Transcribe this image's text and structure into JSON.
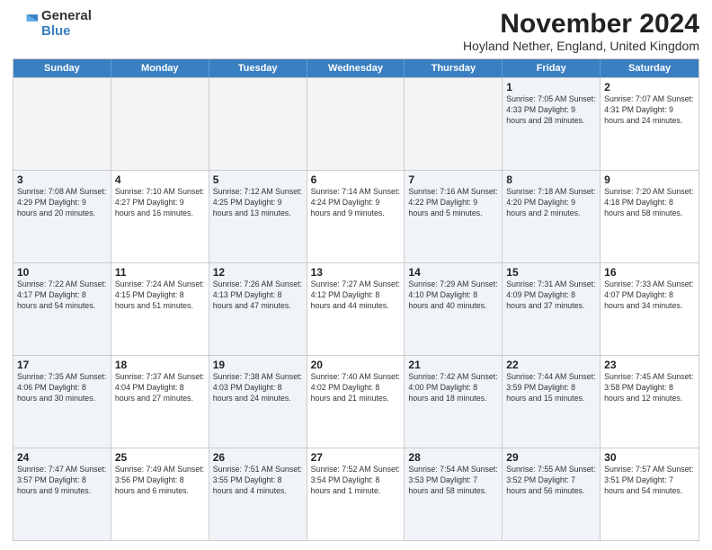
{
  "logo": {
    "general": "General",
    "blue": "Blue"
  },
  "header": {
    "title": "November 2024",
    "subtitle": "Hoyland Nether, England, United Kingdom"
  },
  "days_of_week": [
    "Sunday",
    "Monday",
    "Tuesday",
    "Wednesday",
    "Thursday",
    "Friday",
    "Saturday"
  ],
  "rows": [
    [
      {
        "day": "",
        "info": "",
        "empty": true
      },
      {
        "day": "",
        "info": "",
        "empty": true
      },
      {
        "day": "",
        "info": "",
        "empty": true
      },
      {
        "day": "",
        "info": "",
        "empty": true
      },
      {
        "day": "",
        "info": "",
        "empty": true
      },
      {
        "day": "1",
        "info": "Sunrise: 7:05 AM\nSunset: 4:33 PM\nDaylight: 9 hours and 28 minutes.",
        "shaded": true
      },
      {
        "day": "2",
        "info": "Sunrise: 7:07 AM\nSunset: 4:31 PM\nDaylight: 9 hours and 24 minutes."
      }
    ],
    [
      {
        "day": "3",
        "info": "Sunrise: 7:08 AM\nSunset: 4:29 PM\nDaylight: 9 hours and 20 minutes.",
        "shaded": true
      },
      {
        "day": "4",
        "info": "Sunrise: 7:10 AM\nSunset: 4:27 PM\nDaylight: 9 hours and 16 minutes."
      },
      {
        "day": "5",
        "info": "Sunrise: 7:12 AM\nSunset: 4:25 PM\nDaylight: 9 hours and 13 minutes.",
        "shaded": true
      },
      {
        "day": "6",
        "info": "Sunrise: 7:14 AM\nSunset: 4:24 PM\nDaylight: 9 hours and 9 minutes."
      },
      {
        "day": "7",
        "info": "Sunrise: 7:16 AM\nSunset: 4:22 PM\nDaylight: 9 hours and 5 minutes.",
        "shaded": true
      },
      {
        "day": "8",
        "info": "Sunrise: 7:18 AM\nSunset: 4:20 PM\nDaylight: 9 hours and 2 minutes.",
        "shaded": true
      },
      {
        "day": "9",
        "info": "Sunrise: 7:20 AM\nSunset: 4:18 PM\nDaylight: 8 hours and 58 minutes."
      }
    ],
    [
      {
        "day": "10",
        "info": "Sunrise: 7:22 AM\nSunset: 4:17 PM\nDaylight: 8 hours and 54 minutes.",
        "shaded": true
      },
      {
        "day": "11",
        "info": "Sunrise: 7:24 AM\nSunset: 4:15 PM\nDaylight: 8 hours and 51 minutes."
      },
      {
        "day": "12",
        "info": "Sunrise: 7:26 AM\nSunset: 4:13 PM\nDaylight: 8 hours and 47 minutes.",
        "shaded": true
      },
      {
        "day": "13",
        "info": "Sunrise: 7:27 AM\nSunset: 4:12 PM\nDaylight: 8 hours and 44 minutes."
      },
      {
        "day": "14",
        "info": "Sunrise: 7:29 AM\nSunset: 4:10 PM\nDaylight: 8 hours and 40 minutes.",
        "shaded": true
      },
      {
        "day": "15",
        "info": "Sunrise: 7:31 AM\nSunset: 4:09 PM\nDaylight: 8 hours and 37 minutes.",
        "shaded": true
      },
      {
        "day": "16",
        "info": "Sunrise: 7:33 AM\nSunset: 4:07 PM\nDaylight: 8 hours and 34 minutes."
      }
    ],
    [
      {
        "day": "17",
        "info": "Sunrise: 7:35 AM\nSunset: 4:06 PM\nDaylight: 8 hours and 30 minutes.",
        "shaded": true
      },
      {
        "day": "18",
        "info": "Sunrise: 7:37 AM\nSunset: 4:04 PM\nDaylight: 8 hours and 27 minutes."
      },
      {
        "day": "19",
        "info": "Sunrise: 7:38 AM\nSunset: 4:03 PM\nDaylight: 8 hours and 24 minutes.",
        "shaded": true
      },
      {
        "day": "20",
        "info": "Sunrise: 7:40 AM\nSunset: 4:02 PM\nDaylight: 8 hours and 21 minutes."
      },
      {
        "day": "21",
        "info": "Sunrise: 7:42 AM\nSunset: 4:00 PM\nDaylight: 8 hours and 18 minutes.",
        "shaded": true
      },
      {
        "day": "22",
        "info": "Sunrise: 7:44 AM\nSunset: 3:59 PM\nDaylight: 8 hours and 15 minutes.",
        "shaded": true
      },
      {
        "day": "23",
        "info": "Sunrise: 7:45 AM\nSunset: 3:58 PM\nDaylight: 8 hours and 12 minutes."
      }
    ],
    [
      {
        "day": "24",
        "info": "Sunrise: 7:47 AM\nSunset: 3:57 PM\nDaylight: 8 hours and 9 minutes.",
        "shaded": true
      },
      {
        "day": "25",
        "info": "Sunrise: 7:49 AM\nSunset: 3:56 PM\nDaylight: 8 hours and 6 minutes."
      },
      {
        "day": "26",
        "info": "Sunrise: 7:51 AM\nSunset: 3:55 PM\nDaylight: 8 hours and 4 minutes.",
        "shaded": true
      },
      {
        "day": "27",
        "info": "Sunrise: 7:52 AM\nSunset: 3:54 PM\nDaylight: 8 hours and 1 minute."
      },
      {
        "day": "28",
        "info": "Sunrise: 7:54 AM\nSunset: 3:53 PM\nDaylight: 7 hours and 58 minutes.",
        "shaded": true
      },
      {
        "day": "29",
        "info": "Sunrise: 7:55 AM\nSunset: 3:52 PM\nDaylight: 7 hours and 56 minutes.",
        "shaded": true
      },
      {
        "day": "30",
        "info": "Sunrise: 7:57 AM\nSunset: 3:51 PM\nDaylight: 7 hours and 54 minutes."
      }
    ]
  ]
}
